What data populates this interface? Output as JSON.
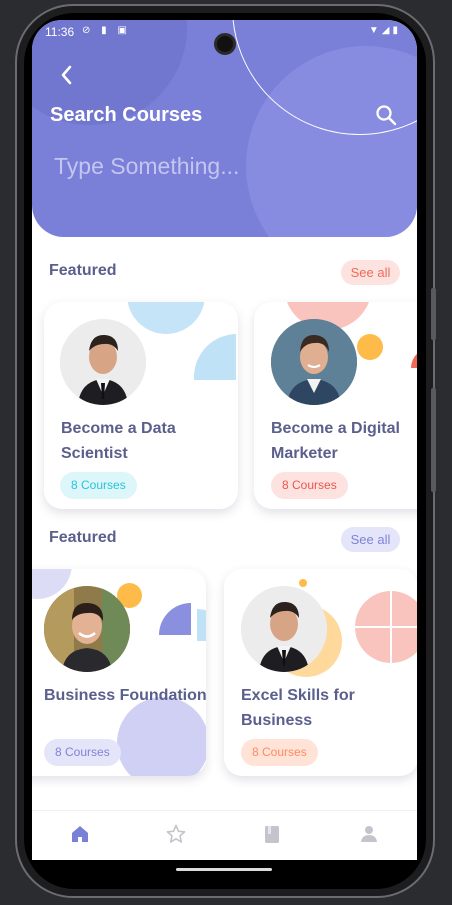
{
  "status": {
    "time": "11:36"
  },
  "header": {
    "title": "Search Courses",
    "search_placeholder": "Type Something..."
  },
  "sections": [
    {
      "title": "Featured",
      "see_all": "See all",
      "cards": [
        {
          "title": "Become a Data Scientist",
          "count": "8 Courses",
          "accent": "#26c6da"
        },
        {
          "title": "Become a Digital Marketer",
          "count": "8 Courses",
          "accent": "#ef5350"
        }
      ]
    },
    {
      "title": "Featured",
      "see_all": "See all",
      "cards": [
        {
          "title": "Business Foundation",
          "count": "8 Courses",
          "accent": "#7e83d9"
        },
        {
          "title": "Excel Skills for Business",
          "count": "8 Courses",
          "accent": "#ff8a65"
        }
      ]
    }
  ],
  "bottom_nav": [
    {
      "icon": "home-icon",
      "active": true
    },
    {
      "icon": "star-icon",
      "active": false
    },
    {
      "icon": "book-icon",
      "active": false
    },
    {
      "icon": "person-icon",
      "active": false
    }
  ],
  "colors": {
    "primary": "#7a7fd8",
    "text": "#5b5f8c"
  }
}
